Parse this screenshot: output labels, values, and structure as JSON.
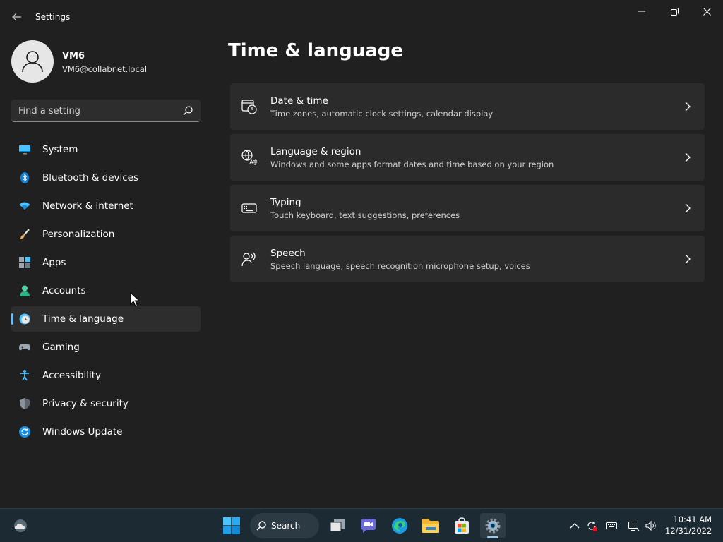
{
  "window": {
    "title": "Settings"
  },
  "profile": {
    "name": "VM6",
    "email": "VM6@collabnet.local"
  },
  "search": {
    "placeholder": "Find a setting"
  },
  "nav": {
    "items": [
      {
        "label": "System",
        "icon": "system-icon"
      },
      {
        "label": "Bluetooth & devices",
        "icon": "bluetooth-icon"
      },
      {
        "label": "Network & internet",
        "icon": "wifi-icon"
      },
      {
        "label": "Personalization",
        "icon": "brush-icon"
      },
      {
        "label": "Apps",
        "icon": "apps-icon"
      },
      {
        "label": "Accounts",
        "icon": "accounts-icon"
      },
      {
        "label": "Time & language",
        "icon": "time-language-icon",
        "selected": true
      },
      {
        "label": "Gaming",
        "icon": "gamepad-icon"
      },
      {
        "label": "Accessibility",
        "icon": "accessibility-icon"
      },
      {
        "label": "Privacy & security",
        "icon": "shield-icon"
      },
      {
        "label": "Windows Update",
        "icon": "update-icon"
      }
    ]
  },
  "main": {
    "title": "Time & language",
    "cards": [
      {
        "title": "Date & time",
        "description": "Time zones, automatic clock settings, calendar display",
        "icon": "calendar-clock-icon"
      },
      {
        "title": "Language & region",
        "description": "Windows and some apps format dates and time based on your region",
        "icon": "language-icon"
      },
      {
        "title": "Typing",
        "description": "Touch keyboard, text suggestions, preferences",
        "icon": "keyboard-icon"
      },
      {
        "title": "Speech",
        "description": "Speech language, speech recognition microphone setup, voices",
        "icon": "speech-icon"
      }
    ]
  },
  "taskbar": {
    "search_label": "Search",
    "time": "10:41 AM",
    "date": "12/31/2022"
  },
  "colors": {
    "background": "#202020",
    "card": "#2b2b2b",
    "accent": "#76b9ed",
    "taskbar": "#1c2a33"
  }
}
